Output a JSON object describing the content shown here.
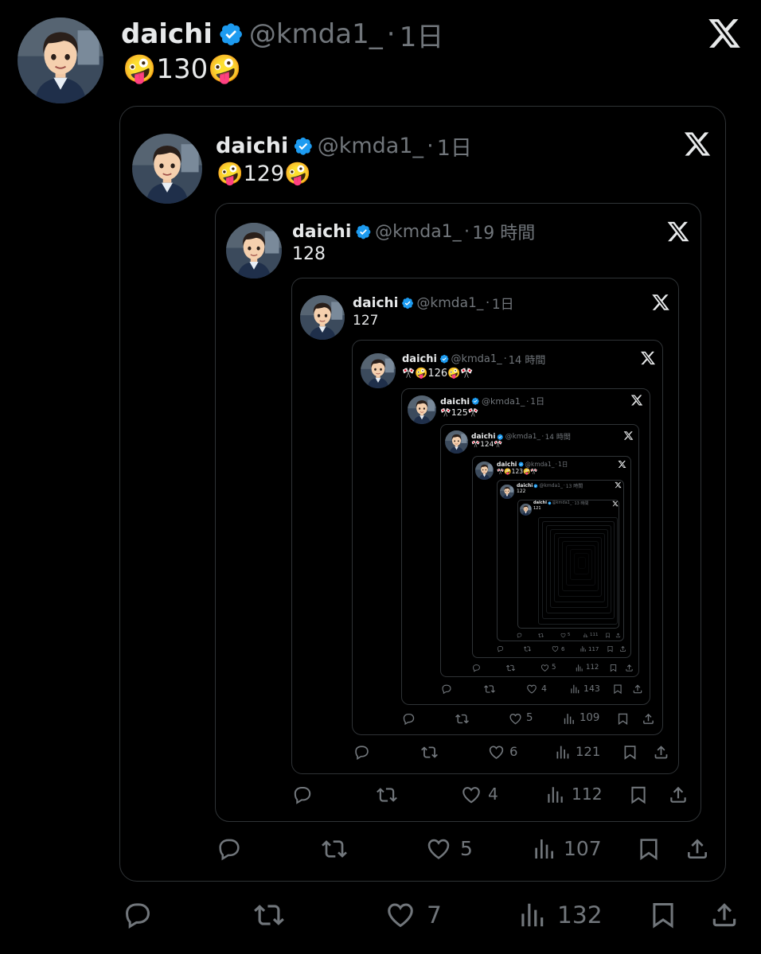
{
  "posts": [
    {
      "name": "daichi",
      "handle": "@kmda1_",
      "time": "1日",
      "text": "🤪130🤪",
      "reply": "",
      "retweet": "",
      "like": "7",
      "views": "132"
    },
    {
      "name": "daichi",
      "handle": "@kmda1_",
      "time": "1日",
      "text": "🤪129🤪",
      "reply": "",
      "retweet": "",
      "like": "5",
      "views": "107"
    },
    {
      "name": "daichi",
      "handle": "@kmda1_",
      "time": "19 時間",
      "text": "128",
      "reply": "",
      "retweet": "",
      "like": "4",
      "views": "112"
    },
    {
      "name": "daichi",
      "handle": "@kmda1_",
      "time": "1日",
      "text": "127",
      "reply": "",
      "retweet": "",
      "like": "6",
      "views": "121"
    },
    {
      "name": "daichi",
      "handle": "@kmda1_",
      "time": "14 時間",
      "text": "🎌🤪126🤪🎌",
      "reply": "",
      "retweet": "",
      "like": "5",
      "views": "109"
    },
    {
      "name": "daichi",
      "handle": "@kmda1_",
      "time": "1日",
      "text": "🎌125🎌",
      "reply": "",
      "retweet": "",
      "like": "4",
      "views": "143"
    },
    {
      "name": "daichi",
      "handle": "@kmda1_",
      "time": "14 時間",
      "text": "🎌124🎌",
      "reply": "",
      "retweet": "",
      "like": "5",
      "views": "112"
    },
    {
      "name": "daichi",
      "handle": "@kmda1_",
      "time": "1日",
      "text": "🎌🤪123🤪🎌",
      "reply": "",
      "retweet": "",
      "like": "6",
      "views": "117"
    },
    {
      "name": "daichi",
      "handle": "@kmda1_",
      "time": "13 時間",
      "text": "122",
      "reply": "",
      "retweet": "",
      "like": "5",
      "views": "111"
    },
    {
      "name": "daichi",
      "handle": "@kmda1_",
      "time": "13 時間",
      "text": "121",
      "reply": "",
      "retweet": "",
      "like": "",
      "views": ""
    }
  ],
  "icons": {
    "verified": "verified-badge-icon",
    "x": "x-logo-icon",
    "reply": "reply-icon",
    "retweet": "retweet-icon",
    "like": "like-icon",
    "views": "views-icon",
    "bookmark": "bookmark-icon",
    "share": "share-icon"
  },
  "colors": {
    "background": "#000000",
    "text": "#e7e9ea",
    "muted": "#71767b",
    "verified": "#1d9bf0",
    "border": "#2f3336"
  }
}
